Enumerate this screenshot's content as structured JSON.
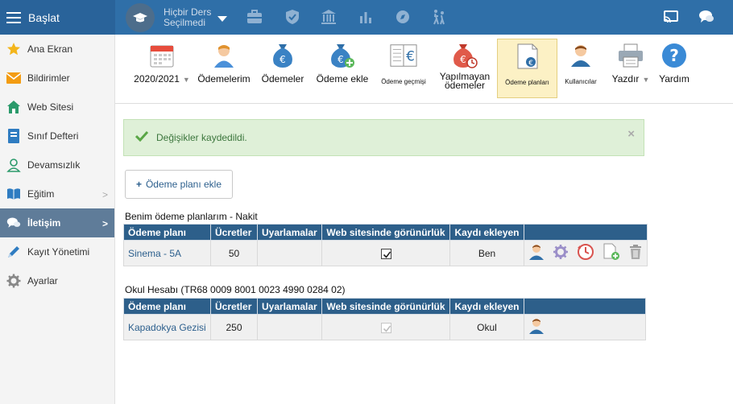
{
  "topbar": {
    "start_label": "Başlat",
    "course_line1": "Hiçbir Ders",
    "course_line2": "Seçilmedi"
  },
  "sidebar": {
    "items": [
      {
        "label": "Ana Ekran"
      },
      {
        "label": "Bildirimler"
      },
      {
        "label": "Web Sitesi"
      },
      {
        "label": "Sınıf Defteri"
      },
      {
        "label": "Devamsızlık"
      },
      {
        "label": "Eğitim"
      },
      {
        "label": "İletişim"
      },
      {
        "label": "Kayıt Yönetimi"
      },
      {
        "label": "Ayarlar"
      }
    ]
  },
  "toolbar": {
    "year": "2020/2021",
    "my_payments": "Ödemelerim",
    "payments": "Ödemeler",
    "add_payment": "Ödeme ekle",
    "payment_history": "Ödeme geçmişi",
    "unpaid_line1": "Yapılmayan",
    "unpaid_line2": "ödemeler",
    "payment_plans": "Ödeme planları",
    "users": "Kullanıcılar",
    "print": "Yazdır",
    "help": "Yardım"
  },
  "alert": {
    "message": "Değişikler kaydedildi.",
    "close": "×"
  },
  "add_plan_button": "Ödeme planı ekle",
  "columns": {
    "plan": "Ödeme planı",
    "fees": "Ücretler",
    "warnings": "Uyarlamalar",
    "visibility": "Web sitesinde görünürlük",
    "registered_by": "Kaydı ekleyen"
  },
  "section1": {
    "title": "Benim ödeme planlarım - Nakit",
    "rows": [
      {
        "plan": "Sinema - 5A",
        "fees": "50",
        "warnings": "",
        "visible": true,
        "registered_by": "Ben"
      }
    ]
  },
  "section2": {
    "title": "Okul Hesabı (TR68 0009 8001 0023 4990 0284 02)",
    "rows": [
      {
        "plan": "Kapadokya Gezisi",
        "fees": "250",
        "warnings": "",
        "visible": true,
        "registered_by": "Okul"
      }
    ]
  }
}
